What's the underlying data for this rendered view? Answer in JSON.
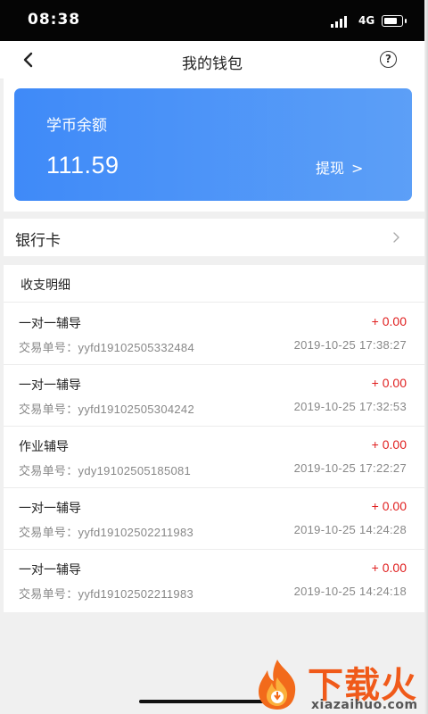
{
  "status_bar": {
    "time": "08:38",
    "network": "4G"
  },
  "header": {
    "title": "我的钱包"
  },
  "balance_card": {
    "label": "学币余额",
    "amount": "111.59",
    "withdraw_label": "提现",
    "chevron": ">",
    "colors": {
      "start": "#3f8af8",
      "end": "#5c9ff7"
    }
  },
  "bank_card": {
    "label": "银行卡"
  },
  "transactions": {
    "header": "收支明细",
    "id_label": "交易单号：",
    "items": [
      {
        "title": "一对一辅导",
        "amount": "+ 0.00",
        "id": "yyfd19102505332484",
        "time": "2019-10-25 17:38:27"
      },
      {
        "title": "一对一辅导",
        "amount": "+ 0.00",
        "id": "yyfd19102505304242",
        "time": "2019-10-25 17:32:53"
      },
      {
        "title": "作业辅导",
        "amount": "+ 0.00",
        "id": "ydy19102505185081",
        "time": "2019-10-25 17:22:27"
      },
      {
        "title": "一对一辅导",
        "amount": "+ 0.00",
        "id": "yyfd19102502211983",
        "time": "2019-10-25 14:24:28"
      },
      {
        "title": "一对一辅导",
        "amount": "+ 0.00",
        "id": "yyfd19102502211983",
        "time": "2019-10-25 14:24:18"
      }
    ]
  },
  "watermark": {
    "text": "下载火",
    "url": "xiazaihuo.com"
  },
  "icons": {
    "back": "back-arrow-icon",
    "help": "question-mark-icon",
    "bank_chevron": "chevron-right-icon",
    "signal": "signal-icon",
    "battery": "battery-icon"
  },
  "accent_color": "#e02020"
}
